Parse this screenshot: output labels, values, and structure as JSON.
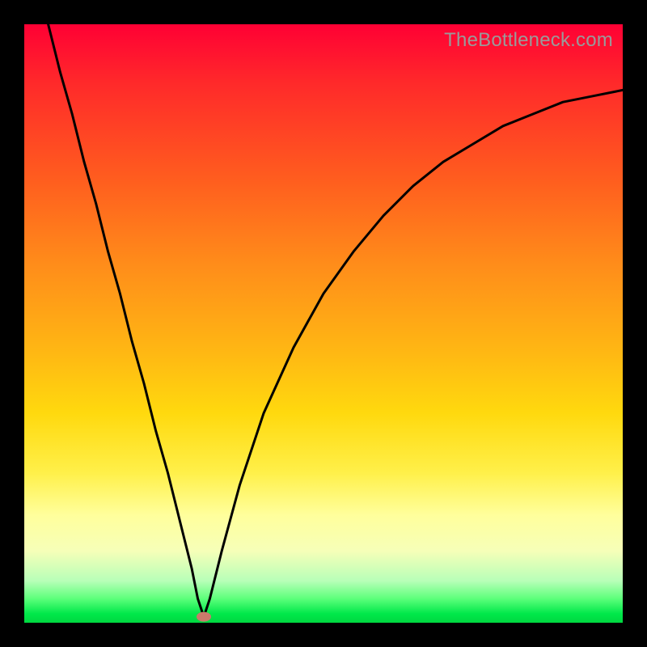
{
  "watermark": "TheBottleneck.com",
  "chart_data": {
    "type": "line",
    "title": "",
    "xlabel": "",
    "ylabel": "",
    "xlim": [
      0,
      1
    ],
    "ylim": [
      0,
      1
    ],
    "min_point": {
      "x": 0.3,
      "y": 0.01
    },
    "series": [
      {
        "name": "curve",
        "x": [
          0.04,
          0.06,
          0.08,
          0.1,
          0.12,
          0.14,
          0.16,
          0.18,
          0.2,
          0.22,
          0.24,
          0.26,
          0.28,
          0.29,
          0.3,
          0.31,
          0.33,
          0.36,
          0.4,
          0.45,
          0.5,
          0.55,
          0.6,
          0.65,
          0.7,
          0.75,
          0.8,
          0.85,
          0.9,
          0.95,
          1.0
        ],
        "y": [
          1.0,
          0.92,
          0.85,
          0.77,
          0.7,
          0.62,
          0.55,
          0.47,
          0.4,
          0.32,
          0.25,
          0.17,
          0.09,
          0.04,
          0.01,
          0.04,
          0.12,
          0.23,
          0.35,
          0.46,
          0.55,
          0.62,
          0.68,
          0.73,
          0.77,
          0.8,
          0.83,
          0.85,
          0.87,
          0.88,
          0.89
        ]
      }
    ],
    "marker": {
      "x": 0.3,
      "y": 0.01,
      "color": "#c97a6b"
    }
  },
  "colors": {
    "curve": "#000000",
    "marker": "#c97a6b",
    "frame": "#000000"
  }
}
